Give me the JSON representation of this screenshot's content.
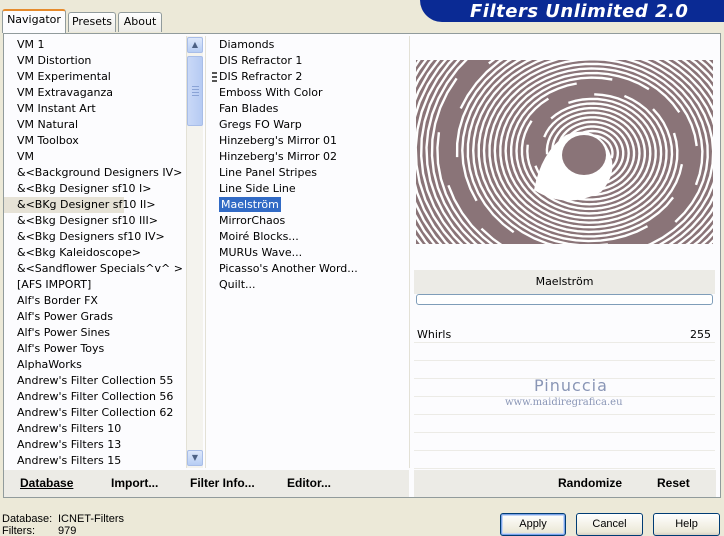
{
  "window": {
    "title": "Filters Unlimited 2.0",
    "tabs": [
      {
        "label": "Navigator",
        "active": true
      },
      {
        "label": "Presets",
        "active": false
      },
      {
        "label": "About",
        "active": false
      }
    ]
  },
  "categories": {
    "selected": "&<BKg Designer sf10 II>",
    "items": [
      "VM 1",
      "VM Distortion",
      "VM Experimental",
      "VM Extravaganza",
      "VM Instant Art",
      "VM Natural",
      "VM Toolbox",
      "VM",
      "&<Background Designers IV>",
      "&<Bkg Designer sf10 I>",
      "&<BKg Designer sf10 II>",
      "&<Bkg Designer sf10 III>",
      "&<Bkg Designers sf10 IV>",
      "&<Bkg Kaleidoscope>",
      "&<Sandflower Specials^v^ >",
      "[AFS IMPORT]",
      "Alf's Border FX",
      "Alf's Power Grads",
      "Alf's Power Sines",
      "Alf's Power Toys",
      "AlphaWorks",
      "Andrew's Filter Collection 55",
      "Andrew's Filter Collection 56",
      "Andrew's Filter Collection 62",
      "Andrew's Filters 10",
      "Andrew's Filters 13",
      "Andrew's Filters 15"
    ]
  },
  "filters": {
    "selected": "Maelström",
    "items": [
      "Diamonds",
      "DIS Refractor 1",
      "DIS Refractor 2",
      "Emboss With Color",
      "Fan Blades",
      "Gregs FO Warp",
      "Hinzeberg's Mirror 01",
      "Hinzeberg's Mirror 02",
      "Line Panel Stripes",
      "Line Side Line",
      "Maelström",
      "MirrorChaos",
      "Moiré Blocks...",
      "MURUs Wave...",
      "Picasso's Another Word...",
      "Quilt..."
    ]
  },
  "preview": {
    "filter_name": "Maelström",
    "params": [
      {
        "name": "Whirls",
        "value": "255"
      }
    ],
    "watermark": "Pinuccia",
    "watermark_url": "www.maidiregrafica.eu",
    "colors": {
      "swirl": "#8a7478",
      "background": "#ffffff"
    }
  },
  "left_actions": {
    "database": "Database",
    "import": "Import...",
    "filter_info": "Filter Info...",
    "editor": "Editor..."
  },
  "right_actions": {
    "randomize": "Randomize",
    "reset": "Reset"
  },
  "footer": {
    "database_label": "Database:",
    "database_value": "ICNET-Filters",
    "filters_label": "Filters:",
    "filters_value": "979"
  },
  "buttons": {
    "apply": "Apply",
    "cancel": "Cancel",
    "help": "Help"
  },
  "icons": {
    "scroll_up": "▲",
    "scroll_down": "▼"
  }
}
